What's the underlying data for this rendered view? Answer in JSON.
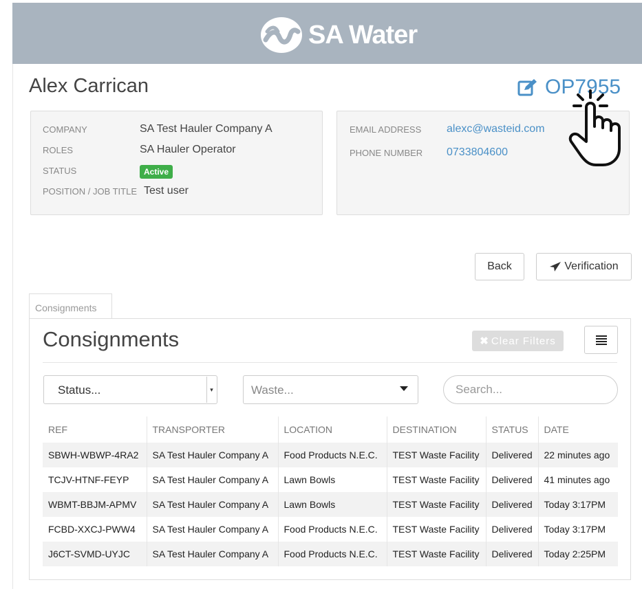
{
  "brand": {
    "name": "SA Water"
  },
  "user": {
    "name": "Alex Carrican",
    "operator_id": "OP7955",
    "company_label": "COMPANY",
    "company": "SA Test Hauler Company A",
    "roles_label": "ROLES",
    "roles": "SA Hauler Operator",
    "status_label": "STATUS",
    "status": "Active",
    "position_label": "POSITION / JOB TITLE",
    "position": "Test user",
    "email_label": "EMAIL ADDRESS",
    "email": "alexc@wasteid.com",
    "phone_label": "PHONE NUMBER",
    "phone": "0733804600"
  },
  "actions": {
    "back_label": "Back",
    "verification_label": "Verification"
  },
  "tab": {
    "label": "Consignments"
  },
  "consignments": {
    "title": "Consignments",
    "clear_filters_label": "Clear Filters",
    "status_select": "Status...",
    "waste_select": "Waste...",
    "search_placeholder": "Search...",
    "columns": [
      "REF",
      "TRANSPORTER",
      "LOCATION",
      "DESTINATION",
      "STATUS",
      "DATE"
    ],
    "rows": [
      [
        "SBWH-WBWP-4RA2",
        "SA Test Hauler Company A",
        "Food Products N.E.C.",
        "TEST Waste Facility",
        "Delivered",
        "22 minutes ago"
      ],
      [
        "TCJV-HTNF-FEYP",
        "SA Test Hauler Company A",
        "Lawn Bowls",
        "TEST Waste Facility",
        "Delivered",
        "41 minutes ago"
      ],
      [
        "WBMT-BBJM-APMV",
        "SA Test Hauler Company A",
        "Lawn Bowls",
        "TEST Waste Facility",
        "Delivered",
        "Today 3:17PM"
      ],
      [
        "FCBD-XXCJ-PWW4",
        "SA Test Hauler Company A",
        "Food Products N.E.C.",
        "TEST Waste Facility",
        "Delivered",
        "Today 3:17PM"
      ],
      [
        "J6CT-SVMD-UYJC",
        "SA Test Hauler Company A",
        "Food Products N.E.C.",
        "TEST Waste Facility",
        "Delivered",
        "Today 2:25PM"
      ]
    ]
  },
  "colors": {
    "header_bg": "#a9b4bf",
    "link": "#4a90c7",
    "active_badge": "#3fae49"
  }
}
